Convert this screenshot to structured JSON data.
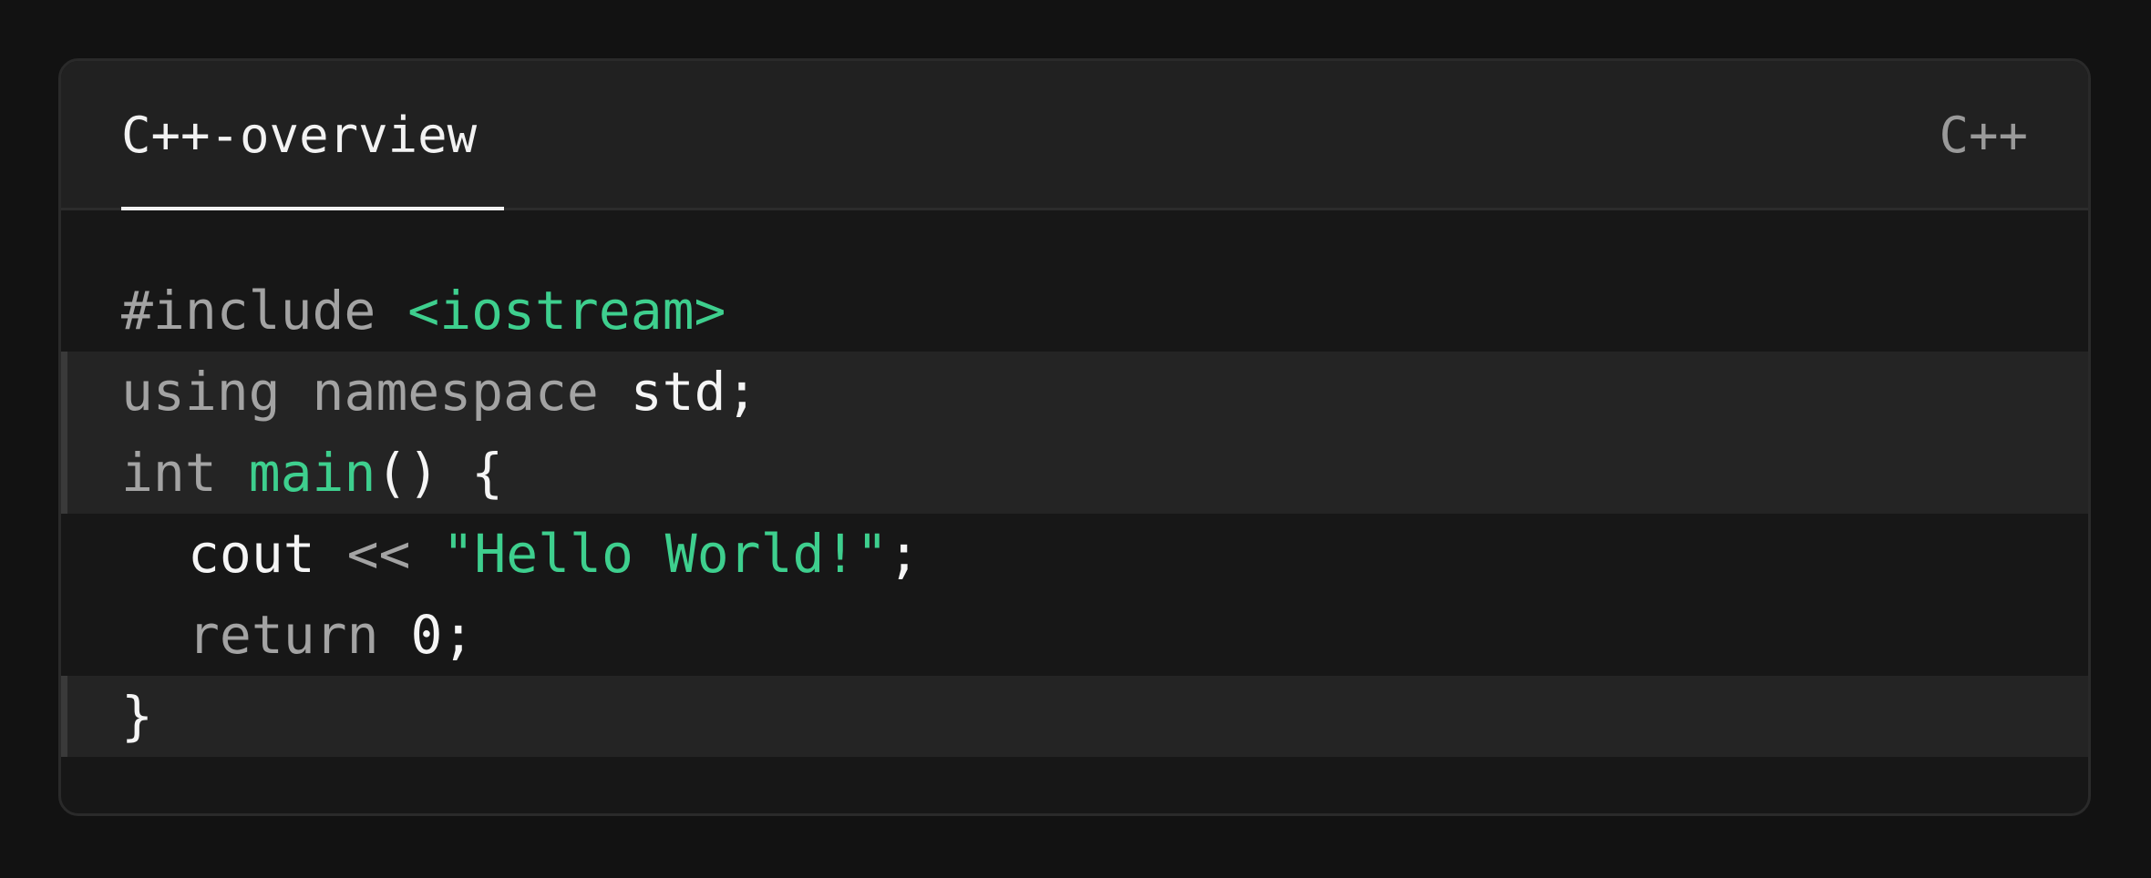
{
  "tab": {
    "label": "C++-overview"
  },
  "language": "C++",
  "colors": {
    "background": "#121212",
    "card": "#171717",
    "header": "#212121",
    "highlight": "#242424",
    "accent_green": "#3ecf8e",
    "keyword_gray": "#a3a3a3",
    "text_white": "#f5f5f5"
  },
  "code": {
    "highlighted_lines": [
      2,
      3,
      6
    ],
    "lines": [
      {
        "t1": "#include",
        "t2": " ",
        "t3": "<iostream>"
      },
      {
        "t1": "using",
        "t2": " ",
        "t3": "namespace",
        "t4": " ",
        "t5": "std;"
      },
      {
        "t1": "int",
        "t2": " ",
        "t3": "main",
        "t4": "() {"
      },
      {
        "t1": "cout",
        "t2": " ",
        "t3": "<<",
        "t4": " ",
        "t5": "\"Hello World!\"",
        "t6": ";"
      },
      {
        "t1": "return",
        "t2": " ",
        "t3": "0;"
      },
      {
        "t1": "}"
      }
    ]
  }
}
